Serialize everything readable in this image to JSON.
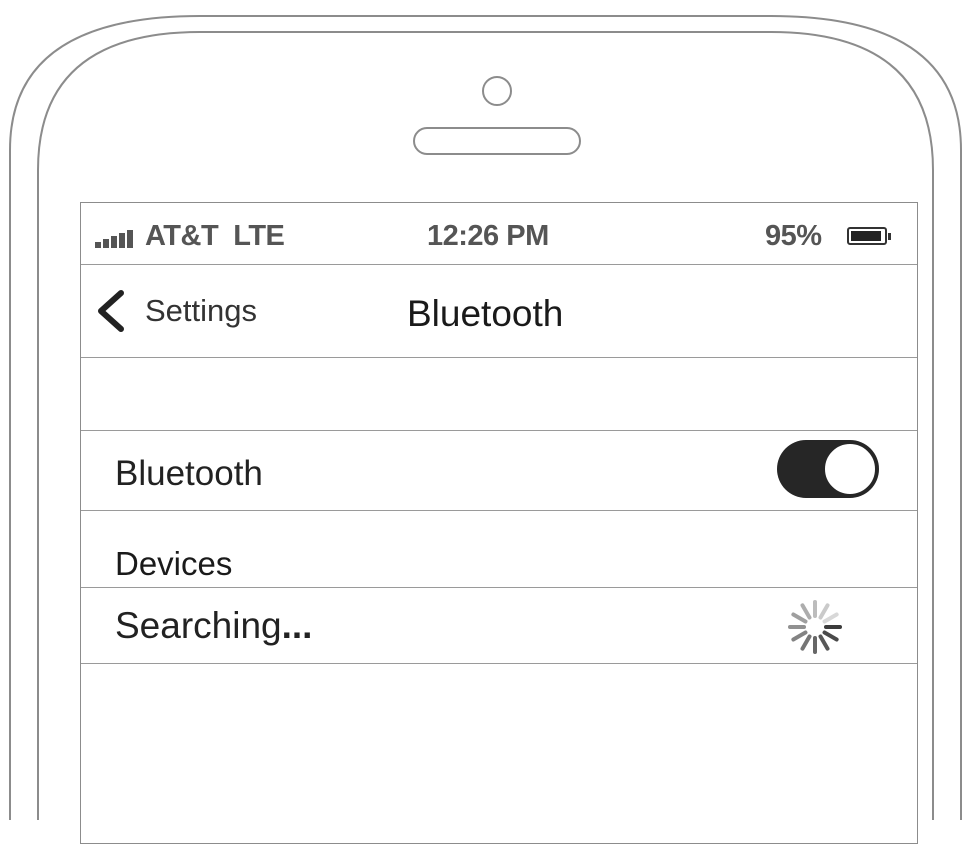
{
  "status_bar": {
    "carrier": "AT&T  LTE",
    "time": "12:26 PM",
    "battery_percent": "95%",
    "battery_level": 0.95,
    "signal_bars": 5,
    "signal_icon": "signal-bars-icon",
    "battery_icon": "battery-icon"
  },
  "nav": {
    "back_label": "Settings",
    "back_icon": "chevron-left-icon",
    "title": "Bluetooth"
  },
  "bluetooth_row": {
    "label": "Bluetooth",
    "toggle_on": true
  },
  "devices": {
    "section_title": "Devices",
    "status": "Searching",
    "status_suffix": "...",
    "spinner_icon": "loading-spinner-icon"
  },
  "colors": {
    "toggle_on": "#262626",
    "divider": "#9a9a9a",
    "frame": "#8c8c8c"
  }
}
